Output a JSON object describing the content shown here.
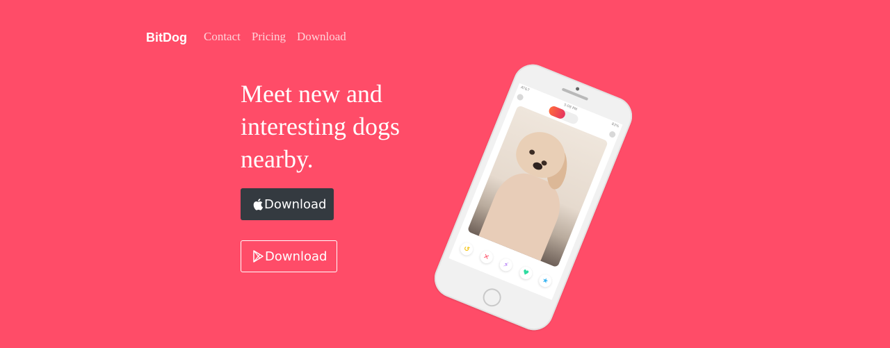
{
  "nav": {
    "brand": "BitDog",
    "links": [
      "Contact",
      "Pricing",
      "Download"
    ]
  },
  "hero": {
    "title": "Meet new and interesting dogs nearby.",
    "buttons": {
      "apple_label": "Download",
      "play_label": "Download"
    }
  },
  "phone": {
    "status_left": "AT&T",
    "status_center": "5:08 PM",
    "status_right": "83%",
    "actions": [
      {
        "icon": "rewind-icon",
        "glyph": "↺",
        "color": "#f5c518"
      },
      {
        "icon": "nope-icon",
        "glyph": "✕",
        "color": "#fd5068"
      },
      {
        "icon": "boost-icon",
        "glyph": "⚡",
        "color": "#a35ff5"
      },
      {
        "icon": "like-icon",
        "glyph": "♥",
        "color": "#2fdba0"
      },
      {
        "icon": "superlike-icon",
        "glyph": "★",
        "color": "#3ab4f2"
      }
    ]
  },
  "colors": {
    "background": "#ff4c68",
    "dark_button": "#343a40",
    "nav_link": "#ffd3da"
  }
}
